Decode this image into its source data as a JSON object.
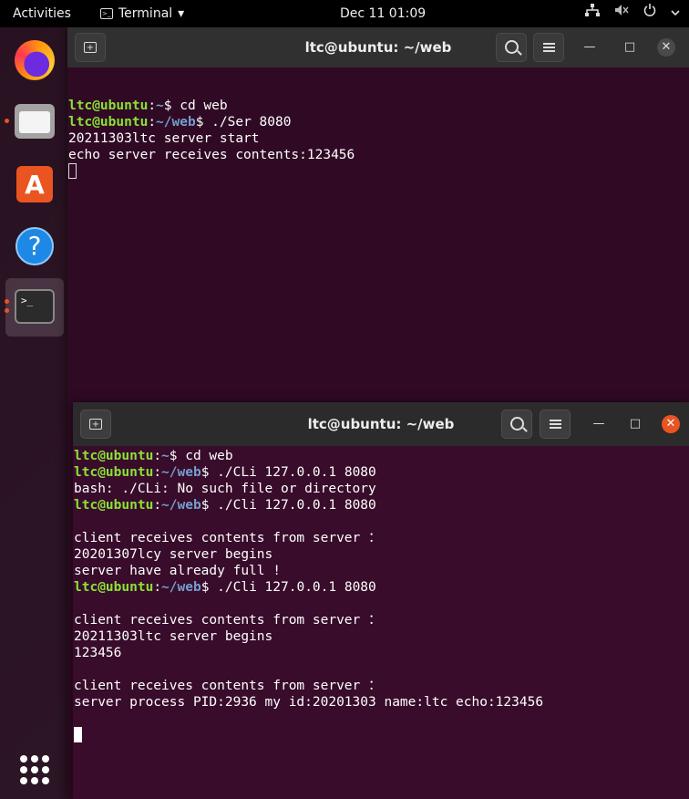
{
  "topbar": {
    "activities": "Activities",
    "app_menu": "Terminal",
    "app_menu_arrow": "▾",
    "clock": "Dec 11  01:09",
    "tray_icons": [
      "network-icon",
      "volume-muted-icon",
      "power-icon",
      "chevron-down-icon"
    ]
  },
  "dock": {
    "apps": [
      "firefox",
      "files",
      "software-store",
      "help",
      "terminal",
      "show-applications"
    ]
  },
  "window_top": {
    "title": "ltc@ubuntu: ~/web",
    "lines": [
      [
        {
          "t": "ltc@ubuntu",
          "c": "user"
        },
        {
          "t": ":",
          "c": ""
        },
        {
          "t": "~",
          "c": "path"
        },
        {
          "t": "$ cd web",
          "c": ""
        }
      ],
      [
        {
          "t": "ltc@ubuntu",
          "c": "user"
        },
        {
          "t": ":",
          "c": ""
        },
        {
          "t": "~/web",
          "c": "path"
        },
        {
          "t": "$ ./Ser 8080",
          "c": ""
        }
      ],
      [
        {
          "t": "20211303ltc server start",
          "c": ""
        }
      ],
      [
        {
          "t": "echo server receives contents:123456",
          "c": ""
        }
      ]
    ]
  },
  "window_bottom": {
    "title": "ltc@ubuntu: ~/web",
    "lines": [
      [
        {
          "t": "ltc@ubuntu",
          "c": "user"
        },
        {
          "t": ":",
          "c": ""
        },
        {
          "t": "~",
          "c": "path"
        },
        {
          "t": "$ cd web",
          "c": ""
        }
      ],
      [
        {
          "t": "ltc@ubuntu",
          "c": "user"
        },
        {
          "t": ":",
          "c": ""
        },
        {
          "t": "~/web",
          "c": "path"
        },
        {
          "t": "$ ./CLi 127.0.0.1 8080",
          "c": ""
        }
      ],
      [
        {
          "t": "bash: ./CLi: No such file or directory",
          "c": ""
        }
      ],
      [
        {
          "t": "ltc@ubuntu",
          "c": "user"
        },
        {
          "t": ":",
          "c": ""
        },
        {
          "t": "~/web",
          "c": "path"
        },
        {
          "t": "$ ./Cli 127.0.0.1 8080",
          "c": ""
        }
      ],
      [],
      [
        {
          "t": "client receives contents from server ：",
          "c": ""
        }
      ],
      [
        {
          "t": "20201307lcy server begins",
          "c": ""
        }
      ],
      [
        {
          "t": "server have already full !",
          "c": ""
        }
      ],
      [
        {
          "t": "ltc@ubuntu",
          "c": "user"
        },
        {
          "t": ":",
          "c": ""
        },
        {
          "t": "~/web",
          "c": "path"
        },
        {
          "t": "$ ./Cli 127.0.0.1 8080",
          "c": ""
        }
      ],
      [],
      [
        {
          "t": "client receives contents from server ：",
          "c": ""
        }
      ],
      [
        {
          "t": "20211303ltc server begins",
          "c": ""
        }
      ],
      [
        {
          "t": "123456",
          "c": ""
        }
      ],
      [],
      [
        {
          "t": "client receives contents from server ：",
          "c": ""
        }
      ],
      [
        {
          "t": "server process PID:2936 my id:20201303 name:ltc echo:123456",
          "c": ""
        }
      ],
      []
    ]
  },
  "colors": {
    "terminal_bg": "#300a24",
    "prompt_user": "#8ae234",
    "prompt_path": "#729fcf",
    "accent": "#e95420"
  }
}
